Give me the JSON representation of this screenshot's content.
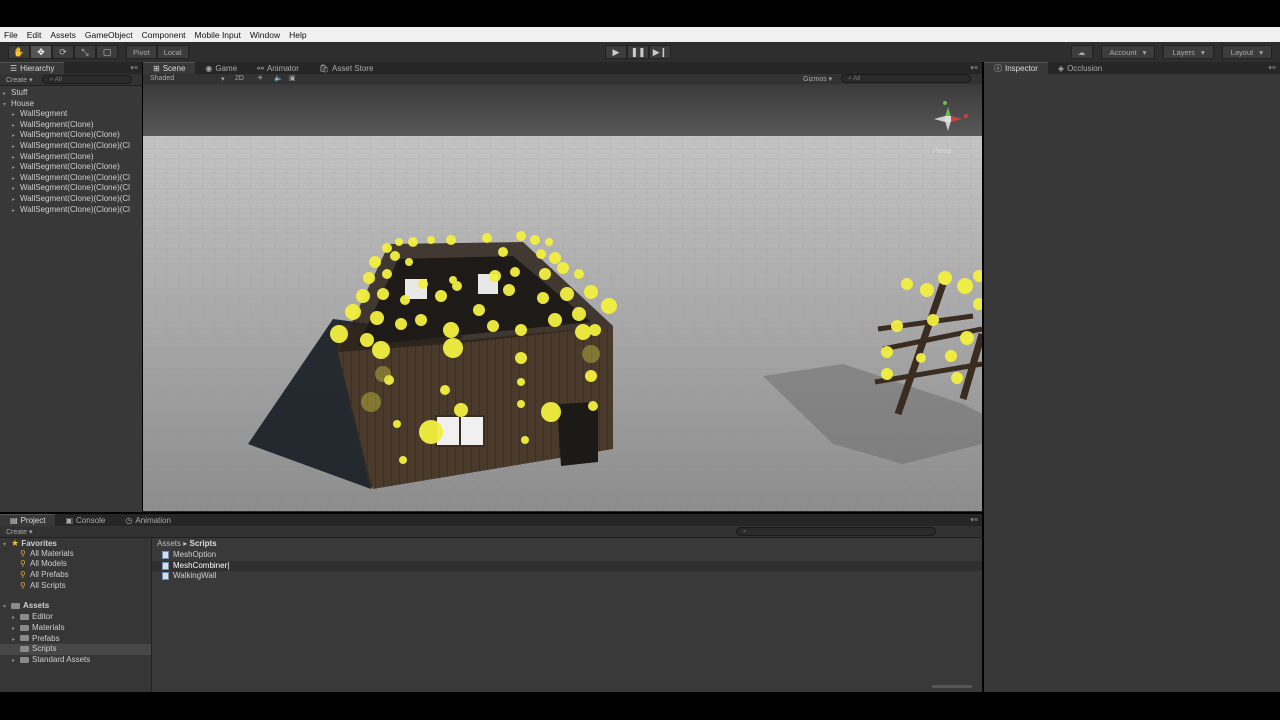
{
  "menu": [
    "File",
    "Edit",
    "Assets",
    "GameObject",
    "Component",
    "Mobile Input",
    "Window",
    "Help"
  ],
  "toolbar": {
    "pivot": "Pivot",
    "local": "Local",
    "account": "Account",
    "layers": "Layers",
    "layout": "Layout"
  },
  "hierarchy": {
    "tab": "Hierarchy",
    "create": "Create",
    "search_placeholder": "All",
    "items": [
      {
        "label": "Stuff",
        "indent": 0,
        "arrow": "▸"
      },
      {
        "label": "House",
        "indent": 0,
        "arrow": "▾"
      },
      {
        "label": "WallSegment",
        "indent": 1,
        "arrow": "▸"
      },
      {
        "label": "WallSegment(Clone)",
        "indent": 1,
        "arrow": "▸"
      },
      {
        "label": "WallSegment(Clone)(Clone)",
        "indent": 1,
        "arrow": "▸"
      },
      {
        "label": "WallSegment(Clone)(Clone)(Cl",
        "indent": 1,
        "arrow": "▸"
      },
      {
        "label": "WallSegment(Clone)",
        "indent": 1,
        "arrow": "▸"
      },
      {
        "label": "WallSegment(Clone)(Clone)",
        "indent": 1,
        "arrow": "▸"
      },
      {
        "label": "WallSegment(Clone)(Clone)(Cl",
        "indent": 1,
        "arrow": "▸"
      },
      {
        "label": "WallSegment(Clone)(Clone)(Cl",
        "indent": 1,
        "arrow": "▸"
      },
      {
        "label": "WallSegment(Clone)(Clone)(Cl",
        "indent": 1,
        "arrow": "▸"
      },
      {
        "label": "WallSegment(Clone)(Clone)(Cl",
        "indent": 1,
        "arrow": "▸"
      }
    ]
  },
  "scene": {
    "tabs": [
      "Scene",
      "Game",
      "Animator",
      "Asset Store"
    ],
    "shaded": "Shaded",
    "mode_2d": "2D",
    "gizmos": "Gizmos",
    "search_placeholder": "All",
    "persp": "Persp"
  },
  "inspector": {
    "tabs": [
      "Inspector",
      "Occlusion"
    ]
  },
  "project": {
    "tabs": [
      "Project",
      "Console",
      "Animation"
    ],
    "create": "Create",
    "favorites_title": "Favorites",
    "favorites": [
      "All Materials",
      "All Models",
      "All Prefabs",
      "All Scripts"
    ],
    "assets_title": "Assets",
    "folders": [
      "Editor",
      "Materials",
      "Prefabs",
      "Scripts",
      "Standard Assets"
    ],
    "selected_folder": "Scripts",
    "breadcrumb_root": "Assets",
    "breadcrumb_current": "Scripts",
    "files": [
      "MeshOption",
      "MeshCombiner|",
      "WalkingWall"
    ],
    "selected_file": "MeshCombiner|"
  }
}
